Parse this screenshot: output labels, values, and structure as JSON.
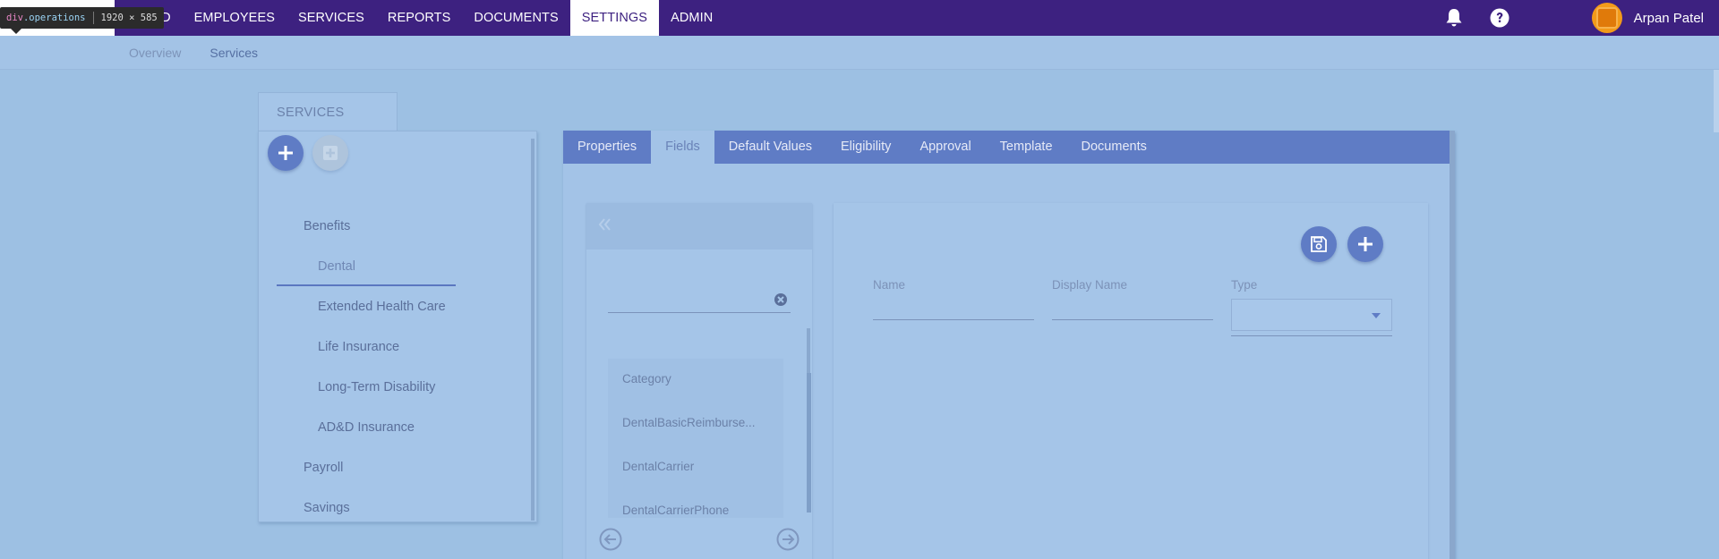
{
  "devtools_tooltip": {
    "tag": "div",
    "class": ".operations",
    "size": "1920 × 585"
  },
  "topnav": {
    "items": [
      "HBOARD",
      "EMPLOYEES",
      "SERVICES",
      "REPORTS",
      "DOCUMENTS",
      "SETTINGS",
      "ADMIN"
    ],
    "active": "SETTINGS",
    "notification_icon": "bell-icon",
    "help_icon": "question-circle-icon",
    "user_name": "Arpan Patel"
  },
  "subnav": {
    "items": [
      "Overview",
      "Services"
    ],
    "active": "Services"
  },
  "services_panel": {
    "title": "SERVICES",
    "add_icon": "plus-icon",
    "add_disabled_icon": "plus-square-icon",
    "tree": [
      {
        "label": "Benefits",
        "expanded": true,
        "children": [
          "Dental",
          "Extended Health Care",
          "Life Insurance",
          "Long-Term Disability",
          "AD&D Insurance"
        ]
      },
      {
        "label": "Payroll",
        "expanded": false
      },
      {
        "label": "Savings",
        "expanded": false
      }
    ],
    "selected": "Dental"
  },
  "editor": {
    "tabs": [
      "Properties",
      "Fields",
      "Default Values",
      "Eligibility",
      "Approval",
      "Template",
      "Documents"
    ],
    "active_tab": "Fields",
    "collapse_icon": "double-chevron-left-icon",
    "search": {
      "value": "",
      "clear_icon": "clear-circle-icon"
    },
    "field_list": [
      "Category",
      "DentalBasicReimburse...",
      "DentalCarrier",
      "DentalCarrierPhone"
    ],
    "prev_icon": "arrow-left-circle-icon",
    "next_icon": "arrow-right-circle-icon",
    "form": {
      "save_icon": "save-icon",
      "add_icon": "plus-icon",
      "name_label": "Name",
      "name_value": "",
      "display_name_label": "Display Name",
      "display_name_value": "",
      "type_label": "Type",
      "type_value": ""
    }
  },
  "colors": {
    "nav_bg": "#3d2180",
    "tab_bar": "#5f7cc5",
    "accent": "#5b77c0",
    "avatar": "#f29a1a"
  }
}
